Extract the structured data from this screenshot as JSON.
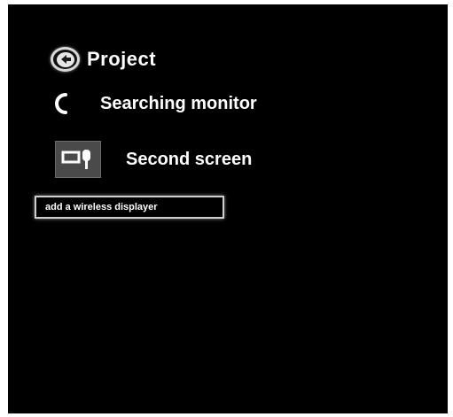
{
  "header": {
    "back_icon": "back-arrow-circle-icon",
    "title": "Project"
  },
  "status": {
    "icon": "loading-spinner-icon",
    "text": "Searching monitor"
  },
  "option": {
    "icon": "monitor-projector-icon",
    "label": "Second screen"
  },
  "add_display_button": {
    "label": "add a wireless displayer"
  },
  "colors": {
    "background": "#000000",
    "text": "#ffffff",
    "icon_tile": "#4a4a4a"
  }
}
